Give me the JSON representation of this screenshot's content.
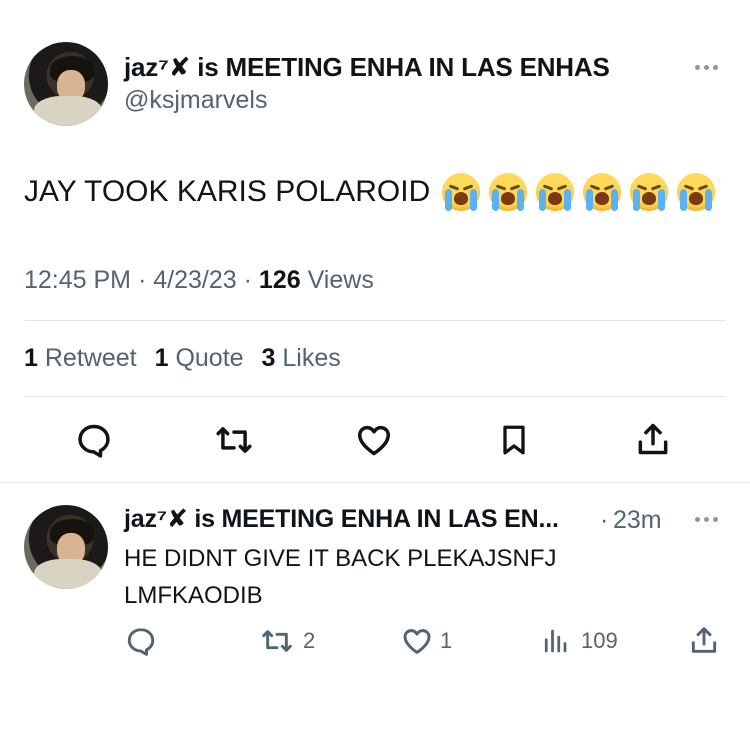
{
  "tweet": {
    "display_name": "jaz⁷✘ is MEETING ENHA IN LAS ENHAS",
    "handle": "@ksjmarvels",
    "text": "JAY TOOK KARIS POLAROID",
    "emojis": [
      "😭",
      "😭",
      "😭",
      "😭",
      "😭",
      "😭"
    ],
    "time": "12:45 PM",
    "date": "4/23/23",
    "separator": "·",
    "views_count": "126",
    "views_label": "Views",
    "retweets_count": "1",
    "retweets_label": "Retweet",
    "quotes_count": "1",
    "quotes_label": "Quote",
    "likes_count": "3",
    "likes_label": "Likes"
  },
  "reply": {
    "display_name": "jaz⁷✘ is MEETING ENHA IN LAS EN...",
    "separator": "·",
    "time_ago": "23m",
    "text_line1": "HE DIDNT GIVE IT BACK PLEKAJSNFJ",
    "text_line2": "LMFKAODIB",
    "retweets": "2",
    "likes": "1",
    "views": "109"
  },
  "icons": {
    "reply": "reply-icon",
    "retweet": "retweet-icon",
    "like": "heart-icon",
    "bookmark": "bookmark-icon",
    "share": "share-icon",
    "views": "views-icon",
    "more": "more-icon"
  },
  "colors": {
    "text": "#0f1419",
    "secondary": "#536471",
    "divider": "#e1e6ea"
  }
}
